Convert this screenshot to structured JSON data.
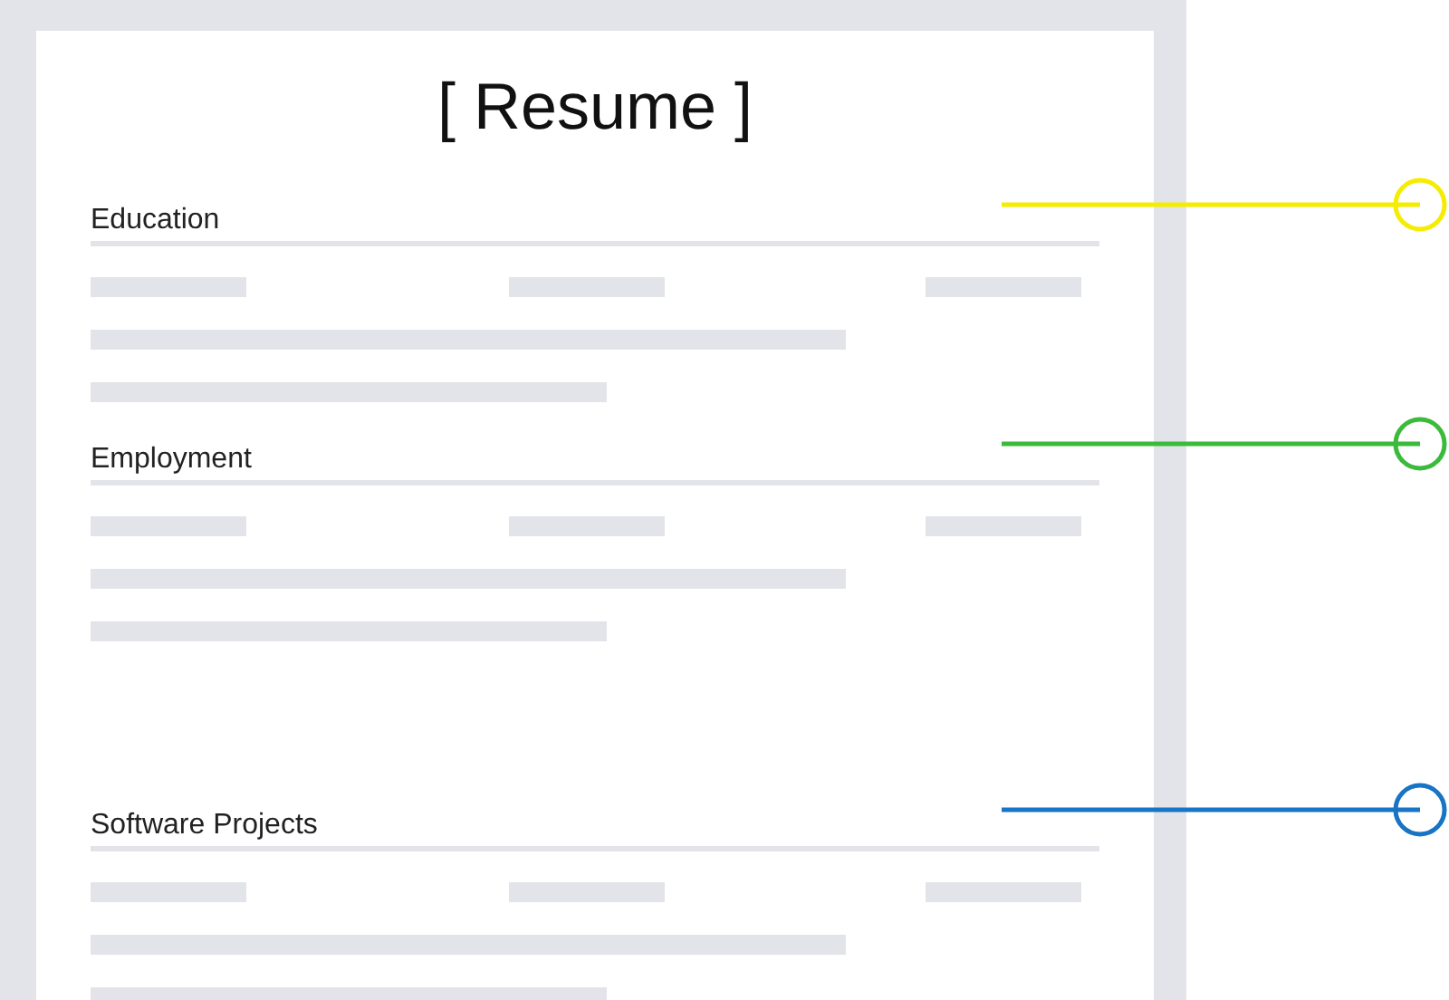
{
  "document": {
    "title": "[ Resume ]",
    "sections": [
      {
        "heading": "Education",
        "color": "#f5ec00"
      },
      {
        "heading": "Employment",
        "color": "#3cba3c"
      },
      {
        "heading": "Software Projects",
        "color": "#1874c4"
      }
    ]
  }
}
